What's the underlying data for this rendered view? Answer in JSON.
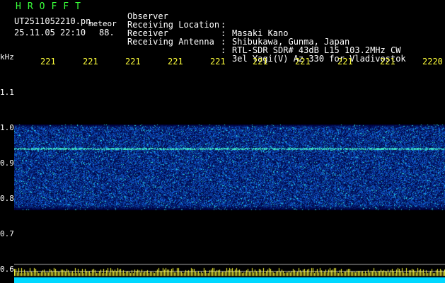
{
  "header": {
    "brand": "HROFFT",
    "filename": "UT2511052210.pn",
    "meteor_label": "meteor",
    "date": "25.11.05",
    "time": "22:10",
    "count": "88."
  },
  "info": [
    {
      "label": "Observer",
      "value": "Masaki Kano"
    },
    {
      "label": "Receiving Location",
      "value": "Shibukawa, Gunma, Japan"
    },
    {
      "label": "Receiver",
      "value": "RTL-SDR SDR# 43dB L15 103.2MHz CW"
    },
    {
      "label": "Receiving Antenna",
      "value": "3el Yagi(V) Az 330 for Vladivostok"
    }
  ],
  "chart_data": {
    "type": "heatmap",
    "ylabel": "kHz",
    "y_ticks": [
      "1.1",
      "1.0",
      "0.9",
      "0.8",
      "0.7",
      "0.6"
    ],
    "x_ticks": [
      "221",
      "221",
      "221",
      "221",
      "221",
      "221",
      "221",
      "221",
      "221",
      "2220"
    ],
    "ylim": [
      0.6,
      1.15
    ],
    "signal_band_khz": [
      0.78,
      1.0
    ],
    "carrier_khz": 0.94,
    "grid": true
  },
  "colors": {
    "background": "#000000",
    "text": "#ffffff",
    "brand": "#39ff3a",
    "ticks": "#ffff3a",
    "noise_base": "#0a1a6e",
    "noise_hi": "#2a6bff",
    "noise_peak": "#39ffd8",
    "bottom_bar": "#00d8ff"
  }
}
